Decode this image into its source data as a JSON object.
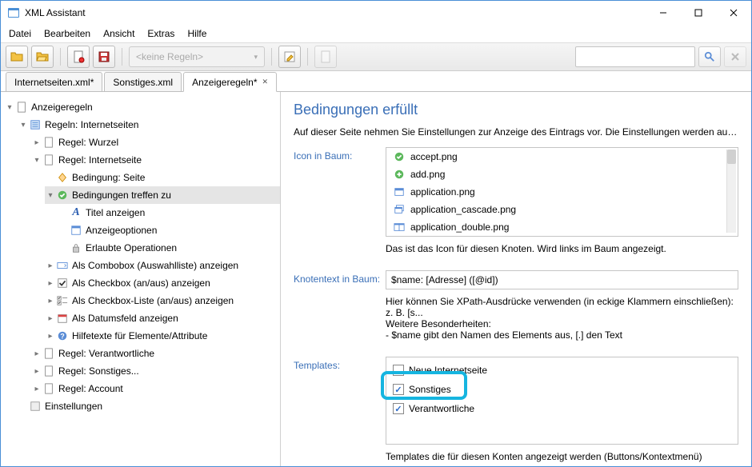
{
  "window": {
    "title": "XML Assistant"
  },
  "menubar": [
    "Datei",
    "Bearbeiten",
    "Ansicht",
    "Extras",
    "Hilfe"
  ],
  "toolbar": {
    "rule_ddl": "<keine Regeln>"
  },
  "tabs": [
    {
      "label": "Internetseiten.xml*",
      "closable": false
    },
    {
      "label": "Sonstiges.xml",
      "closable": false
    },
    {
      "label": "Anzeigeregeln*",
      "closable": true,
      "active": true
    }
  ],
  "tree": {
    "root": "Anzeigeregeln",
    "n1": "Regeln: Internetseiten",
    "n1a": "Regel: Wurzel",
    "n1b": "Regel: Internetseite",
    "n1b1": "Bedingung: Seite",
    "n1b2": "Bedingungen treffen zu",
    "n1b2a": "Titel anzeigen",
    "n1b2b": "Anzeigeoptionen",
    "n1b2c": "Erlaubte Operationen",
    "n1b3": "Als Combobox (Auswahlliste) anzeigen",
    "n1b4": "Als Checkbox (an/aus) anzeigen",
    "n1b5": "Als Checkbox-Liste (an/aus) anzeigen",
    "n1b6": "Als Datumsfeld anzeigen",
    "n1b7": "Hilfetexte für Elemente/Attribute",
    "n1c": "Regel: Verantwortliche",
    "n1d": "Regel: Sonstiges...",
    "n1e": "Regel: Account",
    "n2": "Einstellungen"
  },
  "form": {
    "heading": "Bedingungen erfüllt",
    "desc": "Auf dieser Seite nehmen Sie Einstellungen zur Anzeige des Eintrags vor. Die Einstellungen werden ausgewert...",
    "lbl_icon": "Icon in Baum:",
    "icons": [
      "accept.png",
      "add.png",
      "application.png",
      "application_cascade.png",
      "application_double.png"
    ],
    "help_icon": "Das ist das Icon für diesen Knoten. Wird links im Baum angezeigt.",
    "lbl_knot": "Knotentext in Baum:",
    "knot_val": "$name: [Adresse] ([@id])",
    "help_knot1": "Hier können Sie XPath-Ausdrücke verwenden (in eckige Klammern einschließen): z. B. [s...",
    "help_knot2": "Weitere Besonderheiten:",
    "help_knot3": "- $name gibt den Namen des Elements aus, [.] den Text",
    "lbl_tmpl": "Templates:",
    "templates": [
      {
        "label": "Neue Internetseite",
        "checked": false
      },
      {
        "label": "Sonstiges",
        "checked": true
      },
      {
        "label": "Verantwortliche",
        "checked": true
      }
    ],
    "help_tmpl": "Templates die für diesen Konten angezeigt werden (Buttons/Kontextmenü)"
  }
}
